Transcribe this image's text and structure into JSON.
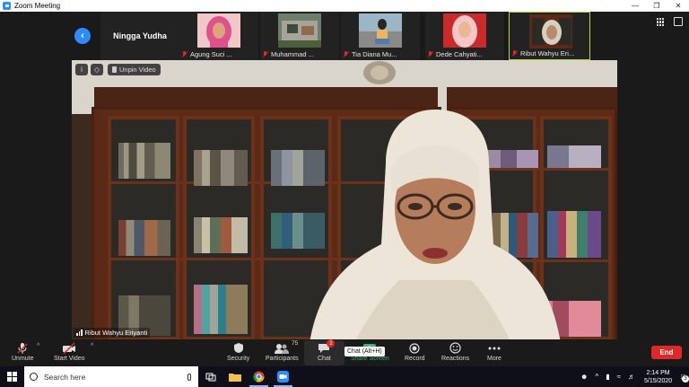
{
  "window": {
    "title": "Zoom Meeting",
    "controls": [
      "minimize",
      "maximize",
      "close"
    ]
  },
  "strip": {
    "active_speaker_name": "Ningga Yudha",
    "thumbnails": [
      {
        "name": "Agung Suci ...",
        "muted": true
      },
      {
        "name": "Muhammad ...",
        "muted": true
      },
      {
        "name": "Tia Diana Mu...",
        "muted": true
      },
      {
        "name": "Dede Cahyati...",
        "muted": true
      },
      {
        "name": "Ribut Wahyu Eri...",
        "muted": true
      }
    ]
  },
  "video": {
    "unpin_label": "Unpin Video",
    "speaker_name": "Ribut Wahyu Eriyanti"
  },
  "toolbar": {
    "unmute": "Unmute",
    "start_video": "Start Video",
    "security": "Security",
    "participants": "Participants",
    "participants_count": "75",
    "chat": "Chat",
    "chat_badge": "2",
    "chat_tooltip": "Chat (Alt+H)",
    "share_screen": "Share Screen",
    "record": "Record",
    "reactions": "Reactions",
    "more": "More",
    "end": "End"
  },
  "taskbar": {
    "search_placeholder": "Search here",
    "time": "2:14 PM",
    "date": "5/15/2020",
    "notifications": "3"
  },
  "colors": {
    "accent": "#2d8cff",
    "end_red": "#e02828",
    "share_green": "#3cb371",
    "active_border": "#b6d33a"
  }
}
